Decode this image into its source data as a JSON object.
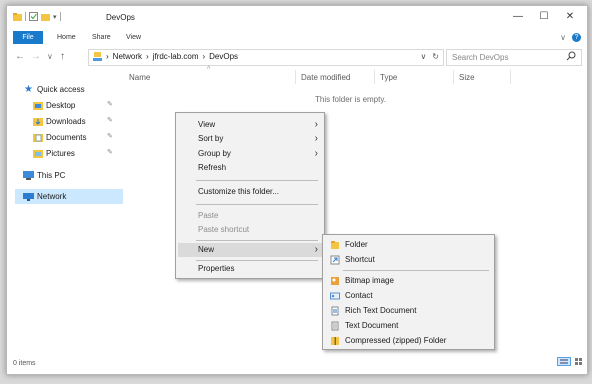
{
  "window": {
    "title": "DevOps",
    "controls": {
      "minimize": "—",
      "maximize": "☐",
      "close": "✕"
    }
  },
  "ribbon": {
    "tabs": [
      "File",
      "Home",
      "Share",
      "View"
    ]
  },
  "address": {
    "crumbs": [
      "Network",
      "jfrdc-lab.com",
      "DevOps"
    ]
  },
  "search": {
    "placeholder": "Search DevOps"
  },
  "sidebar": {
    "items": [
      {
        "label": "Quick access",
        "icon": "star-icon"
      },
      {
        "label": "Desktop",
        "icon": "desktop-folder-icon",
        "pinned": true
      },
      {
        "label": "Downloads",
        "icon": "downloads-folder-icon",
        "pinned": true
      },
      {
        "label": "Documents",
        "icon": "documents-folder-icon",
        "pinned": true
      },
      {
        "label": "Pictures",
        "icon": "pictures-folder-icon",
        "pinned": true
      },
      {
        "label": "This PC",
        "icon": "computer-icon"
      },
      {
        "label": "Network",
        "icon": "network-icon",
        "selected": true
      }
    ]
  },
  "columns": [
    "Name",
    "Date modified",
    "Type",
    "Size"
  ],
  "empty_message": "This folder is empty.",
  "status": {
    "items": "0 items"
  },
  "context_menu": {
    "items": [
      {
        "label": "View",
        "submenu": true
      },
      {
        "label": "Sort by",
        "submenu": true
      },
      {
        "label": "Group by",
        "submenu": true
      },
      {
        "label": "Refresh"
      },
      {
        "label": "Customize this folder..."
      },
      {
        "label": "Paste",
        "disabled": true
      },
      {
        "label": "Paste shortcut",
        "disabled": true
      },
      {
        "label": "New",
        "submenu": true,
        "highlighted": true
      },
      {
        "label": "Properties"
      }
    ]
  },
  "new_submenu": {
    "items": [
      {
        "label": "Folder",
        "icon": "folder-icon"
      },
      {
        "label": "Shortcut",
        "icon": "shortcut-icon"
      },
      {
        "label": "Bitmap image",
        "icon": "bitmap-icon"
      },
      {
        "label": "Contact",
        "icon": "contact-icon"
      },
      {
        "label": "Rich Text Document",
        "icon": "rich-text-icon"
      },
      {
        "label": "Text Document",
        "icon": "text-document-icon"
      },
      {
        "label": "Compressed (zipped) Folder",
        "icon": "zip-folder-icon"
      }
    ]
  },
  "colors": {
    "accent": "#1979ca",
    "folder": "#f4c542",
    "selection": "#cce8ff"
  }
}
